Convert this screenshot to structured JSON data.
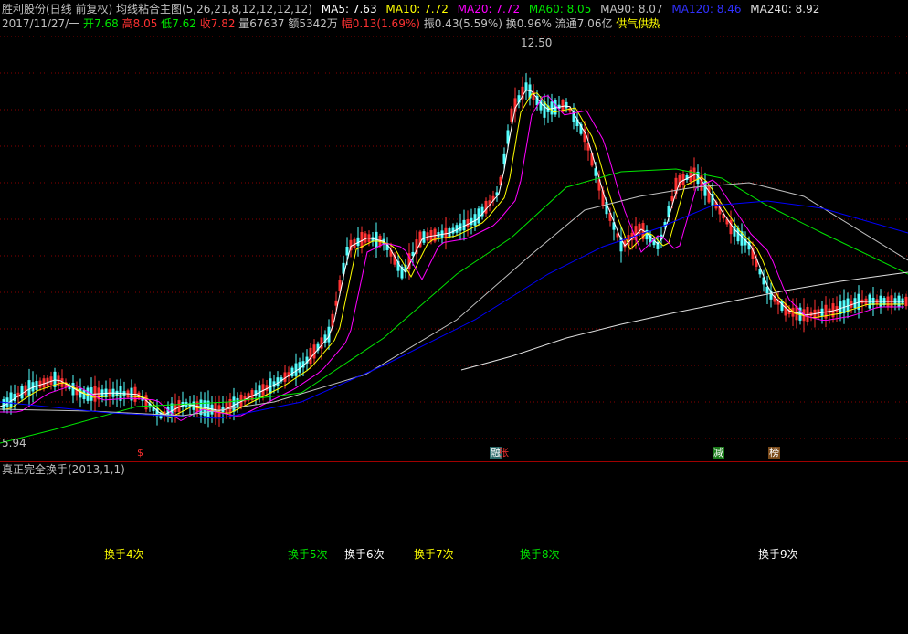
{
  "header": {
    "title": "胜利股份(日线 前复权) 均线粘合主图(5,26,21,8,12,12,12,12)",
    "ma5_label": "MA5:",
    "ma5": "7.63",
    "ma10_label": "MA10:",
    "ma10": "7.72",
    "ma20_label": "MA20:",
    "ma20": "7.72",
    "ma60_label": "MA60:",
    "ma60": "8.05",
    "ma90_label": "MA90:",
    "ma90": "8.07",
    "ma120_label": "MA120:",
    "ma120": "8.46",
    "ma240_label": "MA240:",
    "ma240": "8.92"
  },
  "quote": {
    "date": "2017/11/27/一",
    "open_label": "开",
    "open": "7.68",
    "high_label": "高",
    "high": "8.05",
    "low_label": "低",
    "low": "7.62",
    "close_label": "收",
    "close": "7.82",
    "volume": "量67637",
    "amount": "额5342万",
    "change_label": "幅",
    "change": "0.13(1.69%)",
    "amplitude": "振0.43(5.59%)",
    "turnover": "换0.96%",
    "float_cap": "流通7.06亿",
    "tag": "供气供热"
  },
  "chart": {
    "max_label": "12.50",
    "min_label": "5.94",
    "markers": {
      "dollar": "$",
      "rong": "融",
      "zhang": "张",
      "jian": "减",
      "bang": "榜"
    }
  },
  "indicator": {
    "title": "真正完全换手(2013,1,1)",
    "labels": [
      "换手4次",
      "换手5次",
      "换手6次",
      "换手7次",
      "换手8次",
      "换手9次"
    ]
  },
  "colors": {
    "bg": "#000000",
    "up": "#ff3232",
    "down": "#54ffff",
    "ma5": "#ffffff",
    "ma10": "#ffff00",
    "ma20": "#ff00ff",
    "ma60": "#00e600",
    "ma90": "#c0c0c0",
    "ma120": "#0000ff",
    "ma240": "#e0e0e0"
  }
}
